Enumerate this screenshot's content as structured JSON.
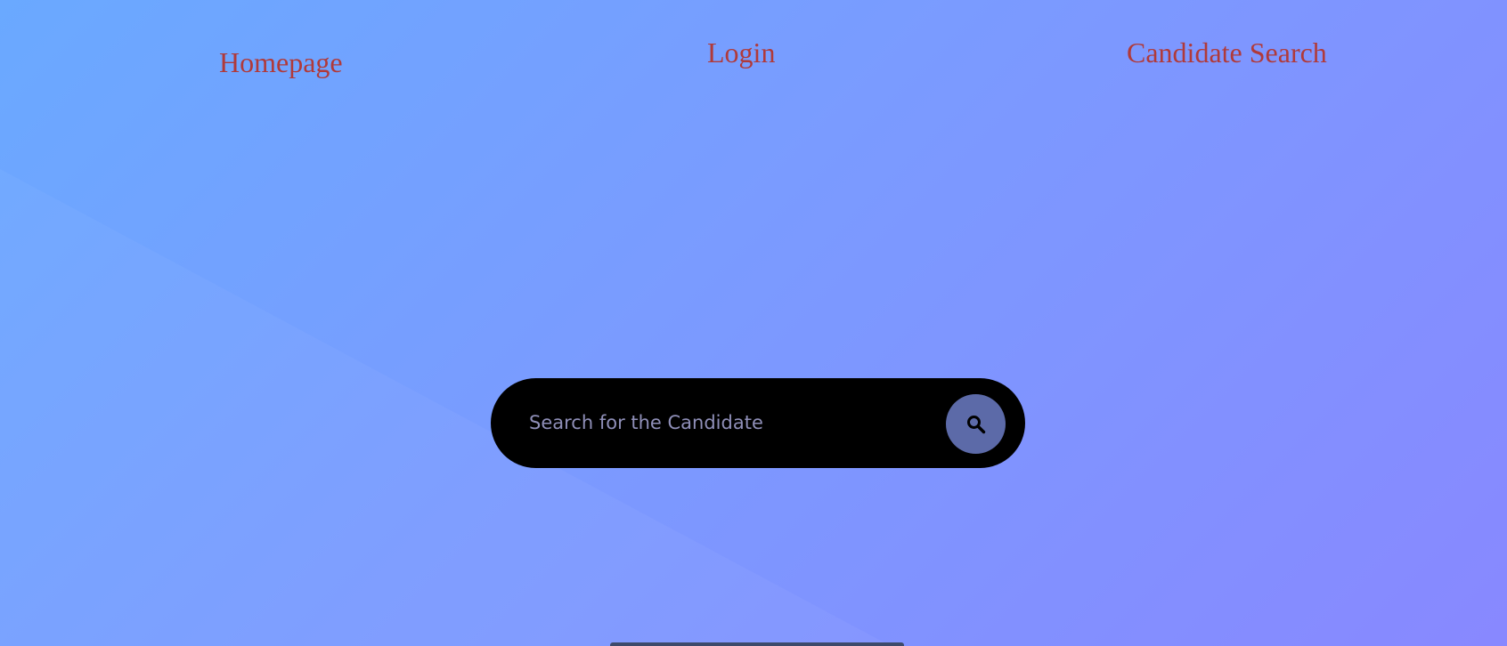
{
  "nav": {
    "items": [
      {
        "label": "Homepage"
      },
      {
        "label": "Login"
      },
      {
        "label": "Candidate Search"
      }
    ]
  },
  "search": {
    "placeholder": "Search for the Candidate",
    "value": "",
    "button_icon": "search-icon"
  },
  "colors": {
    "nav_link": "#b03a3a",
    "search_bar_bg": "#000000",
    "search_button_bg": "#5c6aa8",
    "placeholder": "#8f8fb8",
    "gradient_start": "#6aa9ff",
    "gradient_end": "#8888ff"
  }
}
